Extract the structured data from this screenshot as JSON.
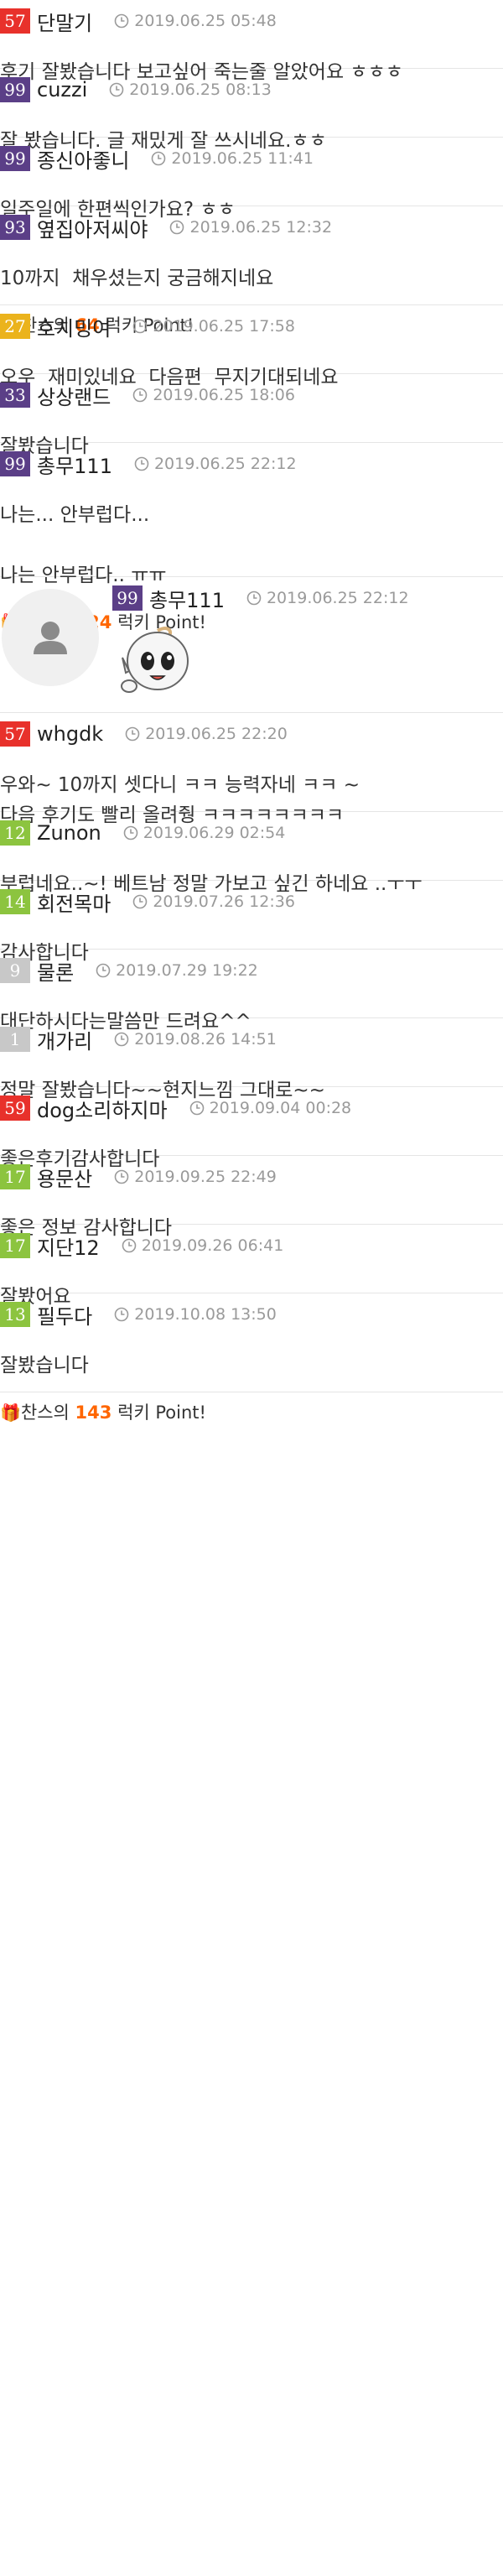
{
  "colors": {
    "level_purple": "#5b3f87",
    "level_red": "#e8312b",
    "level_gold": "#ebb31c",
    "level_green": "#8cc43f",
    "level_gray": "#c8c8c8",
    "point_orange": "#ff6600"
  },
  "comments": [
    {
      "level": "57",
      "level_color": "#e8312b",
      "nick": "단말기",
      "date": "2019.06.25 05:48",
      "text": "후기 잘봤습니다 보고싶어 죽는줄 알았어요 ㅎㅎㅎ"
    },
    {
      "level": "99",
      "level_color": "#5b3f87",
      "nick": "cuzzi",
      "date": "2019.06.25 08:13",
      "text": "잘 봤습니다. 글 재밌게 잘 쓰시네요.ㅎㅎ"
    },
    {
      "level": "99",
      "level_color": "#5b3f87",
      "nick": "종신아좋니",
      "date": "2019.06.25 11:41",
      "text": "일주일에 한편씩인가요? ㅎㅎ"
    },
    {
      "level": "93",
      "level_color": "#5b3f87",
      "nick": "옆집아저씨야",
      "date": "2019.06.25 12:32",
      "text": "10까지  채우셨는지 궁금해지네요",
      "point_prefix": "찬스의 ",
      "point_value": "64",
      "point_suffix": " 럭키 Point!"
    },
    {
      "level": "27",
      "level_color": "#ebb31c",
      "nick": "호치밍여",
      "date": "2019.06.25 17:58",
      "text": "오우  재미있네요  다음편  무지기대되네요"
    },
    {
      "level": "33",
      "level_color": "#5b3f87",
      "nick": "상상랜드",
      "date": "2019.06.25 18:06",
      "text": "잘봤습니다"
    },
    {
      "level": "99",
      "level_color": "#5b3f87",
      "nick": "총무111",
      "date": "2019.06.25 22:12",
      "text": "나는... 안부럽다...\n\n나는 안부럽다.. ㅠㅠ",
      "point_prefix": "찬스의 ",
      "point_value": "324",
      "point_suffix": " 럭키 Point!"
    },
    {
      "level": "99",
      "level_color": "#5b3f87",
      "nick": "총무111",
      "date": "2019.06.25 22:12",
      "is_reply": true
    },
    {
      "level": "57",
      "level_color": "#e8312b",
      "nick": "whgdk",
      "date": "2019.06.25 22:20",
      "text": "우와~ 10까지 셋다니 ㅋㅋ 능력자네 ㅋㅋ ~\n다음 후기도 빨리 올려줭 ㅋㅋㅋㅋㅋㅋㅋㅋ"
    },
    {
      "level": "12",
      "level_color": "#8cc43f",
      "nick": "Zunon",
      "date": "2019.06.29 02:54",
      "text": "부럽네요..~! 베트남 정말 가보고 싶긴 하네요 ..ㅜㅜ"
    },
    {
      "level": "14",
      "level_color": "#8cc43f",
      "nick": "회전목마",
      "date": "2019.07.26 12:36",
      "text": "감사합니다"
    },
    {
      "level": "9",
      "level_color": "#c8c8c8",
      "nick": "물론",
      "date": "2019.07.29 19:22",
      "text": "대단하시다는말씀만 드려요^^"
    },
    {
      "level": "1",
      "level_color": "#c8c8c8",
      "nick": "개가리",
      "date": "2019.08.26 14:51",
      "text": "정말 잘봤습니다~~현지느낌 그대로~~"
    },
    {
      "level": "59",
      "level_color": "#e8312b",
      "nick": "dog소리하지마",
      "date": "2019.09.04 00:28",
      "text": "좋은후기감사합니다"
    },
    {
      "level": "17",
      "level_color": "#8cc43f",
      "nick": "용문산",
      "date": "2019.09.25 22:49",
      "text": "좋은 정보 감사합니다"
    },
    {
      "level": "17",
      "level_color": "#8cc43f",
      "nick": "지단12",
      "date": "2019.09.26 06:41",
      "text": "잘봤어요"
    },
    {
      "level": "13",
      "level_color": "#8cc43f",
      "nick": "필두다",
      "date": "2019.10.08 13:50",
      "text": "잘봤습니다",
      "point_prefix": "찬스의 ",
      "point_value": "143",
      "point_suffix": " 럭키 Point!"
    }
  ]
}
